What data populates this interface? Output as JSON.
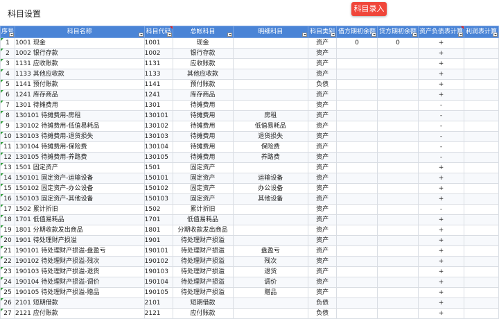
{
  "page_title": "科目设置",
  "entry_button": "科目录入",
  "columns": [
    "序号",
    "科目名称",
    "科目代码",
    "总帐科目",
    "明细科目",
    "科目类别",
    "借方期初余额",
    "贷方期初余额",
    "资产负债表计算",
    "利润表计算"
  ],
  "rows": [
    [
      "1",
      "1001 现金",
      "1001",
      "现金",
      "",
      "资产",
      "0",
      "0",
      "+",
      ""
    ],
    [
      "2",
      "1002 银行存款",
      "1002",
      "银行存款",
      "",
      "资产",
      "",
      "",
      "+",
      ""
    ],
    [
      "3",
      "1131 应收账款",
      "1131",
      "应收账款",
      "",
      "资产",
      "",
      "",
      "+",
      ""
    ],
    [
      "4",
      "1133 其他应收款",
      "1133",
      "其他应收款",
      "",
      "资产",
      "",
      "",
      "+",
      ""
    ],
    [
      "5",
      "1141 预付账款",
      "1141",
      "预付账款",
      "",
      "负债",
      "",
      "",
      "+",
      ""
    ],
    [
      "6",
      "1241 库存商品",
      "1241",
      "库存商品",
      "",
      "资产",
      "",
      "",
      "+",
      ""
    ],
    [
      "7",
      "1301 待摊费用",
      "1301",
      "待摊费用",
      "",
      "资产",
      "",
      "",
      "-",
      ""
    ],
    [
      "8",
      "130101 待摊费用-房租",
      "130101",
      "待摊费用",
      "房租",
      "资产",
      "",
      "",
      "-",
      ""
    ],
    [
      "9",
      "130102 待摊费用-低值易耗品",
      "130102",
      "待摊费用",
      "低值易耗品",
      "资产",
      "",
      "",
      "-",
      ""
    ],
    [
      "10",
      "130103 待摊费用-退货损失",
      "130103",
      "待摊费用",
      "退货损失",
      "资产",
      "",
      "",
      "-",
      ""
    ],
    [
      "11",
      "130104 待摊费用-保险费",
      "130104",
      "待摊费用",
      "保险费",
      "资产",
      "",
      "",
      "-",
      ""
    ],
    [
      "12",
      "130105 待摊费用-养路费",
      "130105",
      "待摊费用",
      "养路费",
      "资产",
      "",
      "",
      "-",
      ""
    ],
    [
      "13",
      "1501 固定资产",
      "1501",
      "固定资产",
      "",
      "资产",
      "",
      "",
      "+",
      ""
    ],
    [
      "14",
      "150101 固定资产-运输设备",
      "150101",
      "固定资产",
      "运输设备",
      "资产",
      "",
      "",
      "+",
      ""
    ],
    [
      "15",
      "150102 固定资产-办公设备",
      "150102",
      "固定资产",
      "办公设备",
      "资产",
      "",
      "",
      "+",
      ""
    ],
    [
      "16",
      "150103 固定资产-其他设备",
      "150103",
      "固定资产",
      "其他设备",
      "资产",
      "",
      "",
      "+",
      ""
    ],
    [
      "17",
      "1502 累计折旧",
      "1502",
      "累计折旧",
      "",
      "资产",
      "",
      "",
      "-",
      ""
    ],
    [
      "18",
      "1701 低值易耗品",
      "1701",
      "低值易耗品",
      "",
      "资产",
      "",
      "",
      "+",
      ""
    ],
    [
      "19",
      "1801 分期收款发出商品",
      "1801",
      "分期收款发出商品",
      "",
      "资产",
      "",
      "",
      "+",
      ""
    ],
    [
      "20",
      "1901 待处理财产损溢",
      "1901",
      "待处理财产损溢",
      "",
      "资产",
      "",
      "",
      "+",
      ""
    ],
    [
      "21",
      "190101 待处理财产损溢-盘盈亏",
      "190101",
      "待处理财产损溢",
      "盘盈亏",
      "资产",
      "",
      "",
      "+",
      ""
    ],
    [
      "22",
      "190102 待处理财产损溢-残次",
      "190102",
      "待处理财产损溢",
      "残次",
      "资产",
      "",
      "",
      "+",
      ""
    ],
    [
      "23",
      "190103 待处理财产损溢-退货",
      "190103",
      "待处理财产损溢",
      "退货",
      "资产",
      "",
      "",
      "+",
      ""
    ],
    [
      "24",
      "190104 待处理财产损溢-调价",
      "190104",
      "待处理财产损溢",
      "调价",
      "资产",
      "",
      "",
      "+",
      ""
    ],
    [
      "25",
      "190105 待处理财产损溢-赠品",
      "190105",
      "待处理财产损溢",
      "赠品",
      "资产",
      "",
      "",
      "+",
      ""
    ],
    [
      "26",
      "2101 短期借款",
      "2101",
      "短期借款",
      "",
      "负债",
      "",
      "",
      "+",
      ""
    ],
    [
      "27",
      "2121 应付账款",
      "2121",
      "应付账款",
      "",
      "负债",
      "",
      "",
      "+",
      ""
    ]
  ],
  "colors": {
    "header_bg": "#4a84d6",
    "button_bg": "#f0463a"
  }
}
